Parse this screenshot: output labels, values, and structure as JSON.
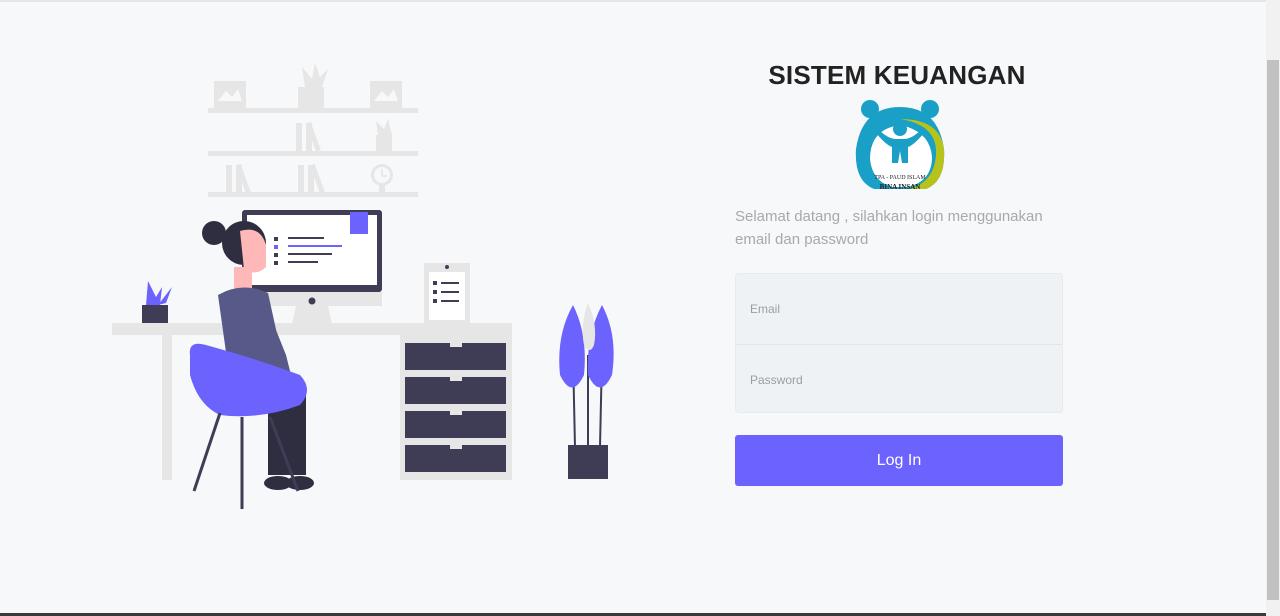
{
  "app": {
    "title": "SISTEM KEUANGAN"
  },
  "logo": {
    "top_text": "TPA - PAUD ISLAM",
    "bottom_text": "BINA   INSAN"
  },
  "welcome_text": "Selamat datang , silahkan login menggunakan email dan password",
  "form": {
    "email_placeholder": "Email",
    "email_value": "",
    "password_placeholder": "Password",
    "password_value": ""
  },
  "login_button": {
    "label": "Log In"
  },
  "colors": {
    "accent": "#6c63ff",
    "dark": "#3f3d56",
    "background": "#f7f8fa"
  }
}
